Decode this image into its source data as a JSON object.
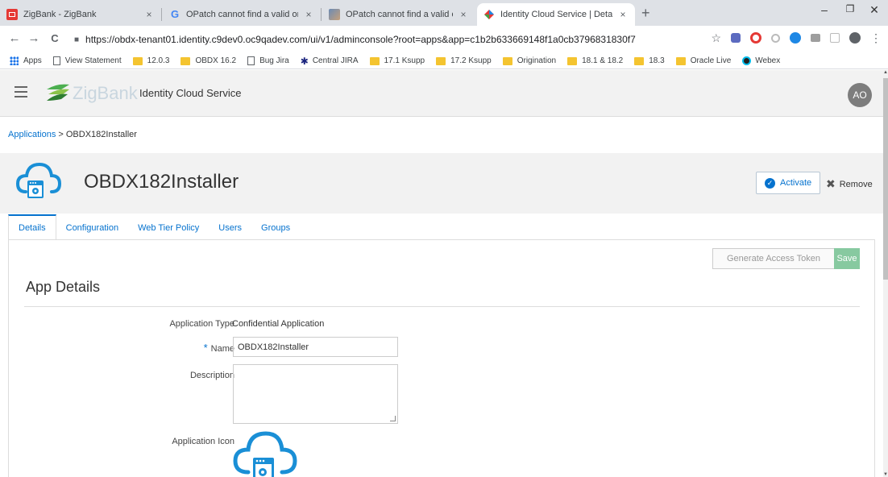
{
  "browser": {
    "tabs": [
      {
        "title": "ZigBank - ZigBank",
        "icon": "zigbank-favicon"
      },
      {
        "title": "OPatch cannot find a valid oraIns",
        "icon": "google-favicon"
      },
      {
        "title": "OPatch cannot find a valid oraIns",
        "icon": "oracle-community-favicon"
      },
      {
        "title": "Identity Cloud Service | Details",
        "icon": "idcs-favicon"
      }
    ],
    "close_glyph": "×",
    "new_tab_glyph": "+",
    "window_controls": {
      "minimize": "–",
      "restore": "❐",
      "close": "✕"
    },
    "nav": {
      "back": "←",
      "forward": "→",
      "reload": "C"
    },
    "url": "https://obdx-tenant01.identity.c9dev0.oc9qadev.com/ui/v1/adminconsole?root=apps&app=c1b2b633669148f1a0cb3796831830f7",
    "bookmarks": [
      {
        "label": "Apps",
        "icon": "apps-grid-icon"
      },
      {
        "label": "View Statement",
        "icon": "page-icon"
      },
      {
        "label": "12.0.3",
        "icon": "folder-icon"
      },
      {
        "label": "OBDX 16.2",
        "icon": "folder-icon"
      },
      {
        "label": "Bug Jira",
        "icon": "page-icon"
      },
      {
        "label": "Central JIRA",
        "icon": "jira-icon"
      },
      {
        "label": "17.1 Ksupp",
        "icon": "folder-icon"
      },
      {
        "label": "17.2 Ksupp",
        "icon": "folder-icon"
      },
      {
        "label": "Origination",
        "icon": "folder-icon"
      },
      {
        "label": "18.1 & 18.2",
        "icon": "folder-icon"
      },
      {
        "label": "18.3",
        "icon": "folder-icon"
      },
      {
        "label": "Oracle Live",
        "icon": "folder-icon"
      },
      {
        "label": "Webex",
        "icon": "webex-icon"
      }
    ]
  },
  "header": {
    "brand": "ZigBank",
    "title": "Identity Cloud Service",
    "avatar_initials": "AO"
  },
  "breadcrumb": {
    "parent": "Applications",
    "separator": " > ",
    "current": "OBDX182Installer"
  },
  "page": {
    "title": "OBDX182Installer",
    "activate_label": "Activate",
    "remove_label": "Remove"
  },
  "tabs": [
    "Details",
    "Configuration",
    "Web Tier Policy",
    "Users",
    "Groups"
  ],
  "details": {
    "generate_token_label": "Generate Access Token",
    "save_label": "Save",
    "section_title": "App Details",
    "app_type_label": "Application Type",
    "app_type_value": "Confidential Application",
    "name_label": "Name",
    "required_marker": "*",
    "name_value": "OBDX182Installer",
    "description_label": "Description",
    "description_value": "",
    "icon_label": "Application Icon"
  },
  "colors": {
    "link": "#0572ce",
    "save_disabled": "#87c9a0",
    "avatar": "#7d7d7d",
    "brand_green": "#4caf50"
  }
}
